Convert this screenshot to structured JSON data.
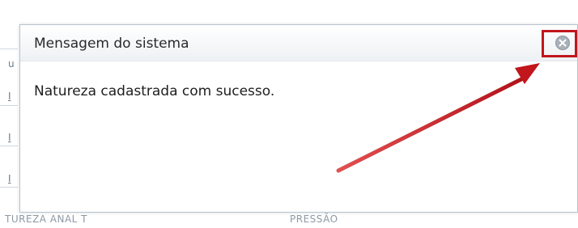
{
  "background": {
    "side_marks": [
      "u",
      "I",
      "I",
      "I"
    ],
    "footer": {
      "col1": "TUREZA ANAL T",
      "col2": "PRESSÃO"
    }
  },
  "dialog": {
    "title": "Mensagem do sistema",
    "message": "Natureza cadastrada com sucesso.",
    "close_icon": "close-circle-icon"
  },
  "annotation": {
    "color": "#c0161c",
    "highlight_target": "close-button"
  }
}
